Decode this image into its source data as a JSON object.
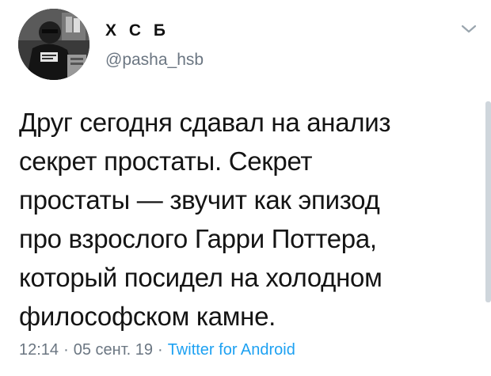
{
  "author": {
    "display_name": "Х С Б",
    "handle": "@pasha_hsb",
    "avatar": "avatar-photo"
  },
  "menu": {
    "icon": "chevron-down-icon"
  },
  "tweet": {
    "lines": [
      "Друг сегодня сдавал на анализ",
      "секрет простаты. Секрет",
      "простаты — звучит как эпизод",
      "про взрослого Гарри Поттера,",
      "который посидел на холодном",
      "философском камне."
    ]
  },
  "meta": {
    "time": "12:14",
    "separator": "·",
    "date": "05 сент. 19",
    "source": "Twitter for Android"
  },
  "colors": {
    "text": "#141414",
    "muted": "#6b7682",
    "link": "#1da1f2"
  }
}
